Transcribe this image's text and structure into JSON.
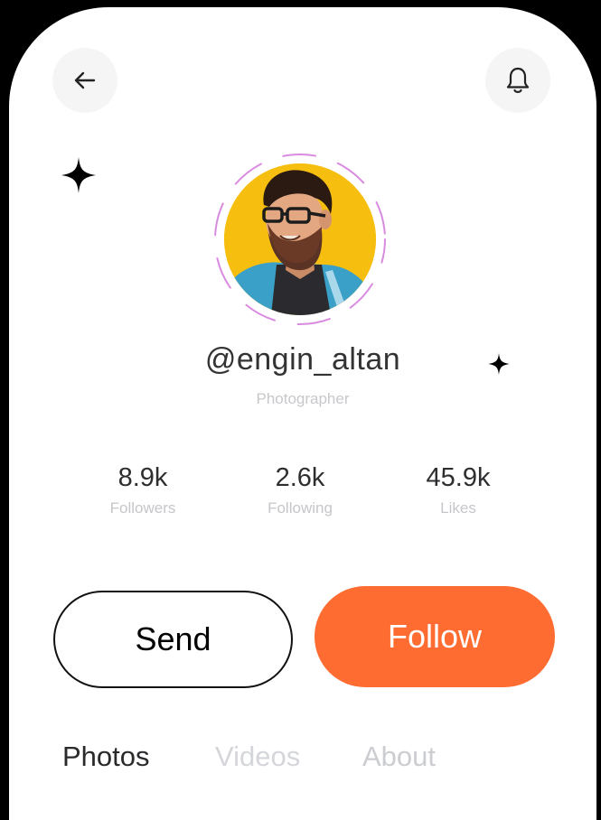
{
  "header": {
    "back_icon": "arrow-left-icon",
    "notification_icon": "bell-icon"
  },
  "profile": {
    "username": "@engin_altan",
    "role": "Photographer",
    "avatar_background": "#f6bf10",
    "ring_color": "#d98be0"
  },
  "stats": [
    {
      "value": "8.9k",
      "label": "Followers"
    },
    {
      "value": "2.6k",
      "label": "Following"
    },
    {
      "value": "45.9k",
      "label": "Likes"
    }
  ],
  "actions": {
    "send_label": "Send",
    "follow_label": "Follow",
    "follow_color": "#ff6c32"
  },
  "tabs": [
    {
      "label": "Photos",
      "active": true
    },
    {
      "label": "Videos",
      "active": false
    },
    {
      "label": "About",
      "active": false
    }
  ]
}
